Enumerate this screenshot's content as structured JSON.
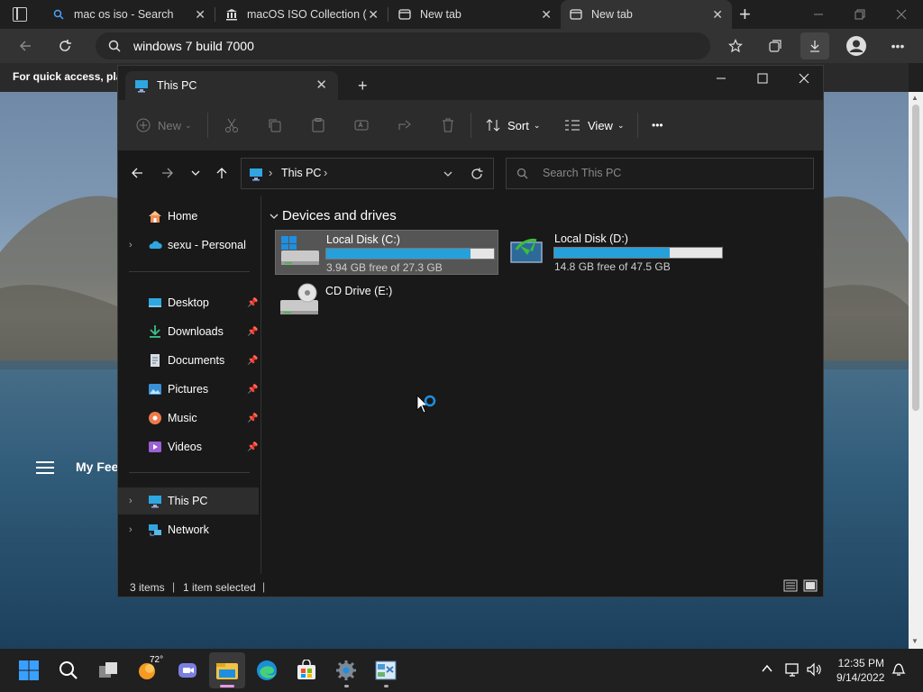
{
  "browser": {
    "tabs": [
      {
        "title": "mac os iso - Search",
        "close": "✕"
      },
      {
        "title": "macOS ISO Collection (",
        "close": "✕"
      },
      {
        "title": "New tab",
        "close": "✕"
      },
      {
        "title": "New tab",
        "close": "✕"
      }
    ],
    "new_tab_label": "+",
    "address": "windows 7 build 7000",
    "favorites_bar_text": "For quick access, plac",
    "my_feed_label": "My Fee"
  },
  "explorer": {
    "tab_title": "This PC",
    "tab_close": "✕",
    "new_tab_label": "+",
    "commands": {
      "new_label": "New",
      "sort_label": "Sort",
      "view_label": "View",
      "more_label": "•••"
    },
    "breadcrumb": {
      "sep": "›",
      "item": "This PC"
    },
    "search_placeholder": "Search This PC",
    "nav": {
      "home": "Home",
      "onedrive": "sexu - Personal",
      "quick_access": [
        {
          "label": "Desktop"
        },
        {
          "label": "Downloads"
        },
        {
          "label": "Documents"
        },
        {
          "label": "Pictures"
        },
        {
          "label": "Music"
        },
        {
          "label": "Videos"
        }
      ],
      "this_pc": "This PC",
      "network": "Network"
    },
    "group_header": "Devices and drives",
    "drives": [
      {
        "name": "Local Disk (C:)",
        "free_text": "3.94 GB free of 27.3 GB",
        "used_fraction": 0.86
      },
      {
        "name": "Local Disk (D:)",
        "free_text": "14.8 GB free of 47.5 GB",
        "used_fraction": 0.69
      },
      {
        "name": "CD Drive (E:)"
      }
    ],
    "status": {
      "items": "3 items",
      "selected": "1 item selected",
      "sep": "|"
    }
  },
  "taskbar": {
    "weather_temp": "72°",
    "time": "12:35 PM",
    "date": "9/14/2022"
  },
  "colors": {
    "accent": "#26a0da",
    "window_bg": "#191919",
    "command_bar": "#2c2c2c"
  }
}
